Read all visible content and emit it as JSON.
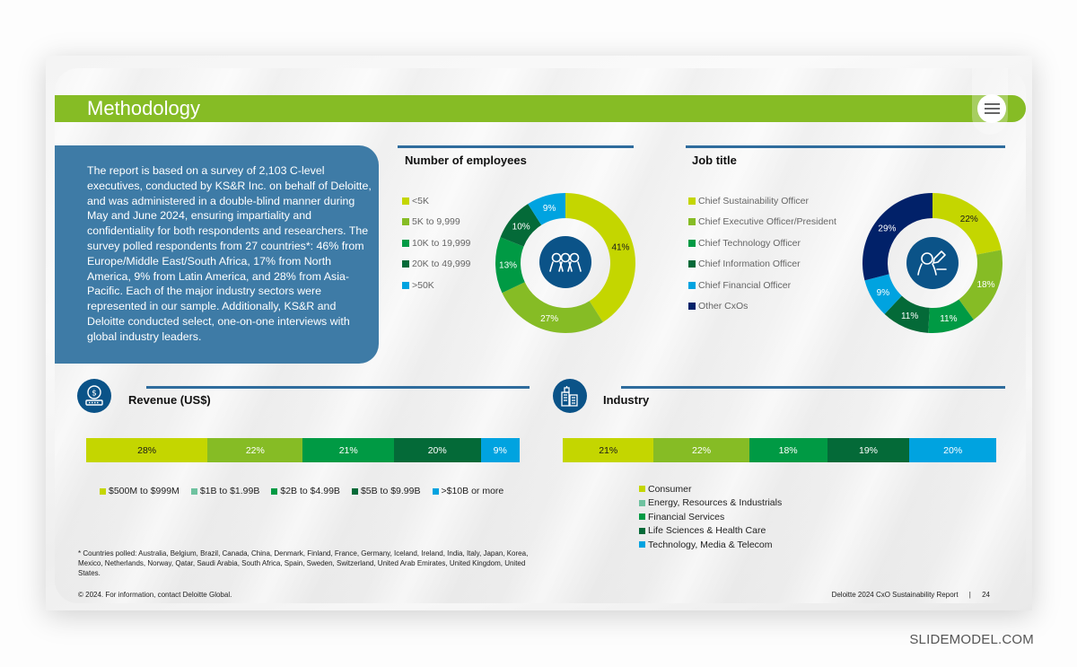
{
  "slide": {
    "title": "Methodology",
    "menu_icon": "hamburger-menu-icon"
  },
  "methodology": {
    "text": "The report is based on a survey of 2,103 C-level executives, conducted by KS&R Inc. on behalf of Deloitte, and was administered in a double-blind manner during May and June 2024, ensuring impartiality and confidentiality for both respondents and researchers. The survey polled respondents from 27 countries*: 46% from Europe/Middle East/South Africa, 17% from North America, 9% from Latin America, and 28% from Asia-Pacific. Each of the major industry sectors were represented in our sample. Additionally, KS&R and Deloitte conducted select, one-on-one interviews with global industry leaders."
  },
  "colors": {
    "lime": "#c4d600",
    "green": "#86bc25",
    "mid_green": "#009a44",
    "dark_green": "#046a38",
    "light_blue": "#00a3e0",
    "navy": "#012169",
    "teal_legend": "#6fc2a0",
    "icon_blue": "#0b5388",
    "rule_blue": "#2f6c9d",
    "method_box": "#3e7ba6",
    "title_bar": "#86bc25"
  },
  "chart_data": [
    {
      "id": "employees",
      "type": "pie",
      "donut": true,
      "title": "Number of employees",
      "center_icon": "people-group-icon",
      "categories": [
        "<5K",
        "5K to 9,999",
        "10K to 19,999",
        "20K to 49,999",
        ">50K"
      ],
      "values": [
        41,
        27,
        13,
        10,
        9
      ],
      "labels": [
        "41%",
        "27%",
        "13%",
        "10%",
        "9%"
      ],
      "colors": [
        "#c4d600",
        "#86bc25",
        "#009a44",
        "#046a38",
        "#00a3e0"
      ],
      "label_colors": [
        "#1a1a1a",
        "#ffffff",
        "#ffffff",
        "#ffffff",
        "#ffffff"
      ],
      "legend": "left"
    },
    {
      "id": "job_title",
      "type": "pie",
      "donut": true,
      "title": "Job title",
      "center_icon": "person-pen-icon",
      "categories": [
        "Chief Sustainability Officer",
        "Chief Executive Officer/President",
        "Chief Technology Officer",
        "Chief Information Officer",
        "Chief Financial Officer",
        "Other CxOs"
      ],
      "values": [
        22,
        18,
        11,
        11,
        9,
        29
      ],
      "labels": [
        "22%",
        "18%",
        "11%",
        "11%",
        "9%",
        "29%"
      ],
      "colors": [
        "#c4d600",
        "#86bc25",
        "#009a44",
        "#046a38",
        "#00a3e0",
        "#012169"
      ],
      "label_colors": [
        "#1a1a1a",
        "#ffffff",
        "#ffffff",
        "#ffffff",
        "#ffffff",
        "#ffffff"
      ],
      "legend": "left"
    },
    {
      "id": "revenue",
      "type": "bar",
      "stacked": true,
      "orientation": "horizontal",
      "title": "Revenue (US$)",
      "title_icon": "money-coin-icon",
      "categories": [
        "$500M to $999M",
        "$1B to $1.99B",
        "$2B to $4.99B",
        "$5B to $9.99B",
        ">$10B or more"
      ],
      "values": [
        28,
        22,
        21,
        20,
        9
      ],
      "labels": [
        "28%",
        "22%",
        "21%",
        "20%",
        "9%"
      ],
      "colors": [
        "#c4d600",
        "#86bc25",
        "#009a44",
        "#046a38",
        "#00a3e0"
      ],
      "legend_colors": [
        "#c4d600",
        "#6fc2a0",
        "#009a44",
        "#046a38",
        "#00a3e0"
      ],
      "label_colors": [
        "#1a1a1a",
        "#ffffff",
        "#ffffff",
        "#ffffff",
        "#ffffff"
      ],
      "legend": "bottom"
    },
    {
      "id": "industry",
      "type": "bar",
      "stacked": true,
      "orientation": "horizontal",
      "title": "Industry",
      "title_icon": "buildings-icon",
      "categories": [
        "Consumer",
        "Energy, Resources & Industrials",
        "Financial Services",
        "Life Sciences & Health Care",
        "Technology, Media & Telecom"
      ],
      "values": [
        21,
        22,
        18,
        19,
        20
      ],
      "labels": [
        "21%",
        "22%",
        "18%",
        "19%",
        "20%"
      ],
      "colors": [
        "#c4d600",
        "#86bc25",
        "#009a44",
        "#046a38",
        "#00a3e0"
      ],
      "legend_colors": [
        "#c4d600",
        "#6fc2a0",
        "#009a44",
        "#046a38",
        "#00a3e0"
      ],
      "label_colors": [
        "#1a1a1a",
        "#ffffff",
        "#ffffff",
        "#ffffff",
        "#ffffff"
      ],
      "legend": "bottom"
    }
  ],
  "footer": {
    "footnote": "* Countries polled: Australia, Belgium, Brazil, Canada, China, Denmark, Finland, France, Germany, Iceland, Ireland, India, Italy, Japan, Korea, Mexico, Netherlands, Norway, Qatar, Saudi Arabia, South Africa, Spain, Sweden, Switzerland, United Arab Emirates, United Kingdom, United States.",
    "copyright": "© 2024. For information, contact Deloitte Global.",
    "report_name": "Deloitte 2024 CxO Sustainability Report",
    "separator": "|",
    "page_number": "24"
  },
  "watermark": "SLIDEMODEL.COM"
}
